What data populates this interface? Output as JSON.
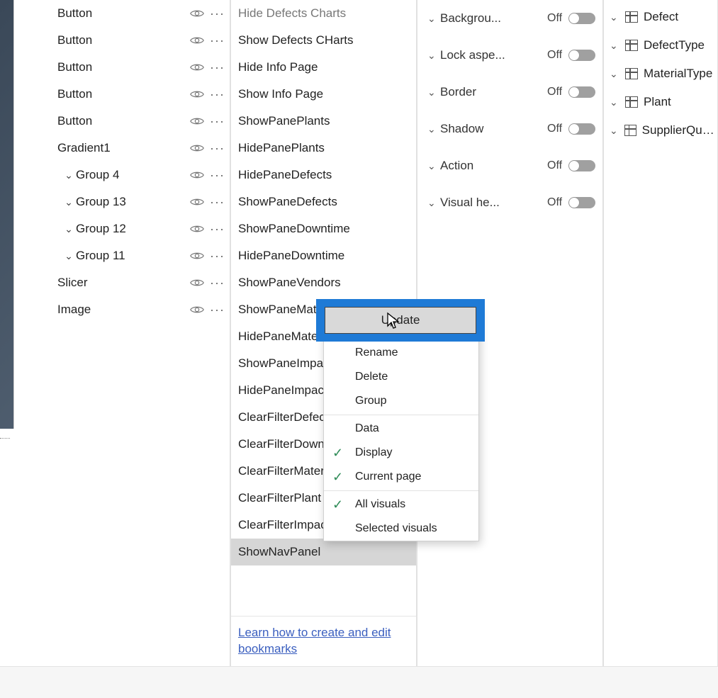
{
  "selection": {
    "items": [
      {
        "label": "Button",
        "indent": 0,
        "chev": false
      },
      {
        "label": "Button",
        "indent": 0,
        "chev": false
      },
      {
        "label": "Button",
        "indent": 0,
        "chev": false
      },
      {
        "label": "Button",
        "indent": 0,
        "chev": false
      },
      {
        "label": "Button",
        "indent": 0,
        "chev": false
      },
      {
        "label": "Gradient1",
        "indent": 0,
        "chev": false
      },
      {
        "label": "Group 4",
        "indent": 1,
        "chev": true
      },
      {
        "label": "Group 13",
        "indent": 1,
        "chev": true
      },
      {
        "label": "Group 12",
        "indent": 1,
        "chev": true
      },
      {
        "label": "Group 11",
        "indent": 1,
        "chev": true
      },
      {
        "label": "Slicer",
        "indent": 0,
        "chev": false
      },
      {
        "label": "Image",
        "indent": 0,
        "chev": false
      }
    ]
  },
  "bookmarks": {
    "items": [
      {
        "label": "Hide Defects Charts",
        "cut": true
      },
      {
        "label": "Show Defects CHarts"
      },
      {
        "label": "Hide Info Page"
      },
      {
        "label": "Show Info Page"
      },
      {
        "label": "ShowPanePlants"
      },
      {
        "label": "HidePanePlants"
      },
      {
        "label": "HidePaneDefects"
      },
      {
        "label": "ShowPaneDefects"
      },
      {
        "label": "ShowPaneDowntime"
      },
      {
        "label": "HidePaneDowntime"
      },
      {
        "label": "ShowPaneVendors"
      },
      {
        "label": "ShowPaneMaterials"
      },
      {
        "label": "HidePaneMaterials"
      },
      {
        "label": "ShowPaneImpact"
      },
      {
        "label": "HidePaneImpact"
      },
      {
        "label": "ClearFilterDefect"
      },
      {
        "label": "ClearFilterDowntime"
      },
      {
        "label": "ClearFilterMaterials"
      },
      {
        "label": "ClearFilterPlant"
      },
      {
        "label": "ClearFilterImpact"
      },
      {
        "label": "ShowNavPanel",
        "selected": true
      }
    ],
    "footer_link": "Learn how to create and edit bookmarks"
  },
  "format": {
    "rows": [
      {
        "label": "Backgrou...",
        "state": "Off"
      },
      {
        "label": "Lock aspe...",
        "state": "Off"
      },
      {
        "label": "Border",
        "state": "Off"
      },
      {
        "label": "Shadow",
        "state": "Off"
      },
      {
        "label": "Action",
        "state": "Off"
      },
      {
        "label": "Visual he...",
        "state": "Off"
      }
    ]
  },
  "fields": {
    "tables": [
      {
        "label": "Defect"
      },
      {
        "label": "DefectType"
      },
      {
        "label": "MaterialType"
      },
      {
        "label": "Plant"
      },
      {
        "label": "SupplierQuality"
      }
    ]
  },
  "context_menu": {
    "highlight": "Update",
    "groups": [
      [
        {
          "label": "Update"
        },
        {
          "label": "Rename"
        },
        {
          "label": "Delete"
        },
        {
          "label": "Group"
        }
      ],
      [
        {
          "label": "Data",
          "checked": false
        },
        {
          "label": "Display",
          "checked": true
        },
        {
          "label": "Current page",
          "checked": true
        }
      ],
      [
        {
          "label": "All visuals",
          "checked": true
        },
        {
          "label": "Selected visuals",
          "checked": false
        }
      ]
    ]
  }
}
